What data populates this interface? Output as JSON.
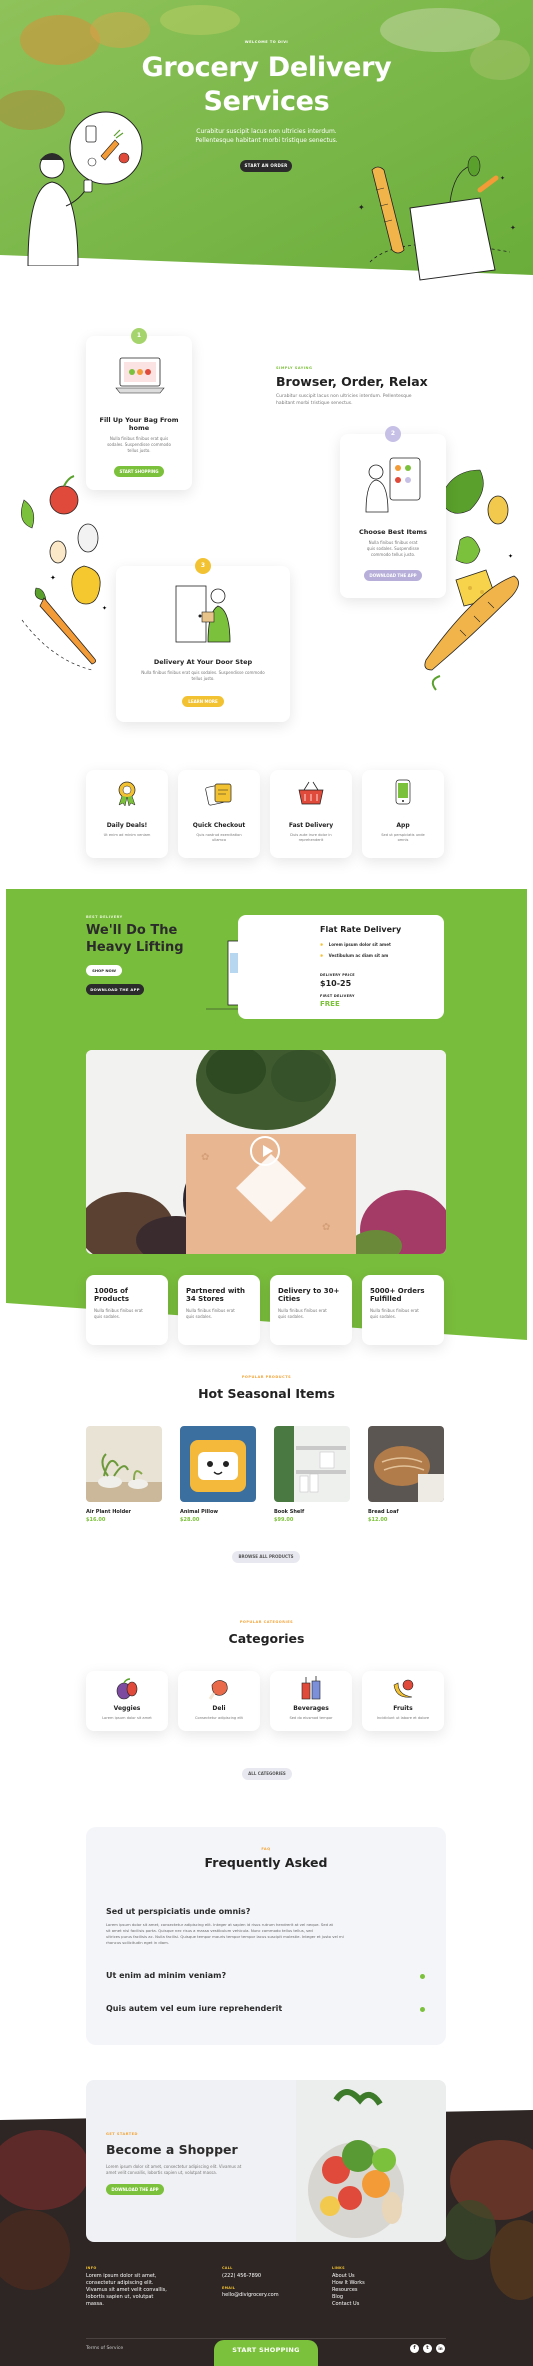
{
  "hero": {
    "eyebrow": "WELCOME TO DIVI",
    "title_line1": "Grocery Delivery",
    "title_line2": "Services",
    "text_line1": "Curabitur suscipit lacus non ultricies interdum.",
    "text_line2": "Pellentesque habitant morbi tristique senectus.",
    "button": "START AN ORDER"
  },
  "steps": {
    "eyebrow": "SIMPLY SAYING",
    "title": "Browser, Order, Relax",
    "text_line1": "Curabitur suscipit lacus non ultricies interdum. Pellentesque",
    "text_line2": "habitant morbi tristique senectus.",
    "items": [
      {
        "num": "1",
        "title_line1": "Fill Up Your Bag From",
        "title_line2": "home",
        "text_line1": "Nulla finibus finibus erat quis",
        "text_line2": "sodales. Suspendisse commodo",
        "text_line3": "tellus justo.",
        "button": "START SHOPPING"
      },
      {
        "num": "2",
        "title_line1": "Choose Best Items",
        "title_line2": "",
        "text_line1": "Nulla finibus finibus erat",
        "text_line2": "quis sodales. Suspendisse",
        "text_line3": "commodo tellus justo.",
        "button": "DOWNLOAD THE APP"
      },
      {
        "num": "3",
        "title_line1": "Delivery At Your Door Step",
        "title_line2": "",
        "text_line1": "Nulla finibus finibus erat quis sodales. Suspendisse commodo",
        "text_line2": "tellus justo.",
        "text_line3": "",
        "button": "LEARN MORE"
      }
    ]
  },
  "features": [
    {
      "title": "Daily Deals!",
      "text_line1": "Ut enim ad minim veniam",
      "text_line2": "",
      "icon": "award-icon"
    },
    {
      "title": "Quick Checkout",
      "text_line1": "Quis nostrud exercitation",
      "text_line2": "ullamco",
      "icon": "cards-icon"
    },
    {
      "title": "Fast Delivery",
      "text_line1": "Duis aute irure dolor in",
      "text_line2": "reprehenderit",
      "icon": "basket-icon"
    },
    {
      "title": "App",
      "text_line1": "Sed ut perspiciatis unde",
      "text_line2": "omnis",
      "icon": "phone-icon"
    }
  ],
  "lifting": {
    "eyebrow": "BEST DELIVERY",
    "title_line1": "We'll Do The",
    "title_line2": "Heavy Lifting",
    "btn_shop": "SHOP NOW",
    "btn_app": "DOWNLOAD THE APP",
    "rate_title": "Flat Rate Delivery",
    "rate_items": [
      "Lorem ipsum dolor sit amet",
      "Vestibulum ac diam sit am"
    ],
    "price_label": "DELIVERY PRICE",
    "price": "$10-25",
    "first_label": "FIRST DELIVERY",
    "first_value": "FREE"
  },
  "stats": [
    {
      "title_line1": "1000s of",
      "title_line2": "Products",
      "text_line1": "Nulla finibus finibus erat",
      "text_line2": "quis sodales."
    },
    {
      "title_line1": "Partnered with",
      "title_line2": "34 Stores",
      "text_line1": "Nulla finibus finibus erat",
      "text_line2": "quis sodales."
    },
    {
      "title_line1": "Delivery to 30+",
      "title_line2": "Cities",
      "text_line1": "Nulla finibus finibus erat",
      "text_line2": "quis sodales."
    },
    {
      "title_line1": "5000+ Orders",
      "title_line2": "Fulfilled",
      "text_line1": "Nulla finibus finibus erat",
      "text_line2": "quis sodales."
    }
  ],
  "seasonal": {
    "eyebrow": "POPULAR PRODUCTS",
    "title": "Hot Seasonal Items",
    "items": [
      {
        "name": "Air Plant Holder",
        "price": "$16.00"
      },
      {
        "name": "Animal Pillow",
        "price": "$28.00"
      },
      {
        "name": "Book Shelf",
        "price": "$99.00"
      },
      {
        "name": "Bread Loaf",
        "price": "$12.00"
      }
    ],
    "button": "BROWSE ALL PRODUCTS"
  },
  "categories": {
    "eyebrow": "POPULAR CATEGORIES",
    "title": "Categories",
    "items": [
      {
        "name": "Veggies",
        "text": "Lorem ipsum dolor sit amet",
        "icon": "eggplant-icon"
      },
      {
        "name": "Deli",
        "text": "Consectetur adipiscing elit",
        "icon": "meat-icon"
      },
      {
        "name": "Beverages",
        "text": "Sed do eiusmod tempor",
        "icon": "drinks-icon"
      },
      {
        "name": "Fruits",
        "text": "Incididunt ut labore et dolore",
        "icon": "banana-icon"
      }
    ],
    "button": "ALL CATEGORIES"
  },
  "faq": {
    "eyebrow": "FAQ",
    "title": "Frequently Asked",
    "questions": [
      {
        "q": "Sed ut perspiciatis unde omnis?",
        "a_lines": [
          "Lorem ipsum dolor sit amet, consectetur adipiscing elit. Integer at sapien id risus rutrum hendrerit at vel neque. Sed at",
          "sit amet nisl facilisis porta. Quisque nec risus a massa vestibulum vehicula. Nunc commodo tellus tellus, sed",
          "ultrices purus facilisis ac. Nulla facilisi. Quisque tempor mauris tempor tempor lacus suscipit molestie. Integer et justo vel mi",
          "rhoncus sollicitudin eget in diam."
        ]
      },
      {
        "q": "Ut enim ad minim veniam?",
        "a_lines": []
      },
      {
        "q": "Quis autem vel eum iure reprehenderit",
        "a_lines": []
      }
    ]
  },
  "shopper": {
    "eyebrow": "GET STARTED",
    "title": "Become a Shopper",
    "text_line1": "Lorem ipsum dolor sit amet, consectetur adipiscing elit. Vivamus at",
    "text_line2": "amet velit convallis, lobortis sapien ut, volutpat massa.",
    "button": "DOWNLOAD THE APP"
  },
  "footer": {
    "col1_label": "INFO",
    "col1_lines": [
      "Lorem ipsum dolor sit amet,",
      "consectetur adipiscing elit.",
      "Vivamus sit amet velit convallis,",
      "lobortis sapien ut, volutpat",
      "massa."
    ],
    "col2_label": "CALL",
    "phone": "(222) 456-7890",
    "col2b_label": "EMAIL",
    "email": "hello@divigrocery.com",
    "col3_label": "LINKS",
    "links": [
      "About Us",
      "How It Works",
      "Resources",
      "Blog",
      "Contact Us"
    ],
    "terms": "Terms of Service",
    "cta": "START SHOPPING",
    "social": [
      "f",
      "t",
      "in"
    ]
  },
  "colors": {
    "green": "#7cc13b",
    "dark": "#2b2b2b",
    "yellow": "#f3c233",
    "purple": "#b7afd9"
  }
}
